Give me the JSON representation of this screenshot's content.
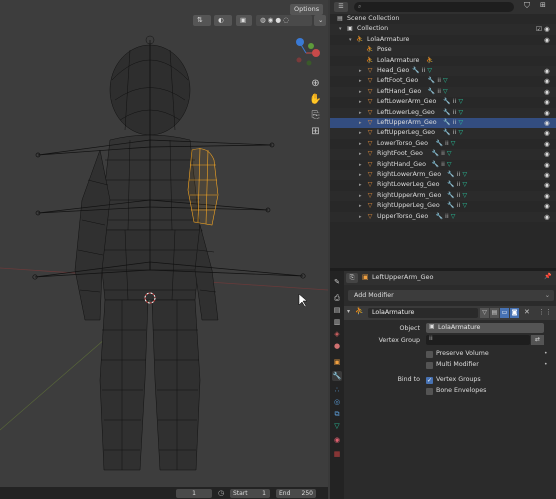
{
  "viewport": {
    "options_label": "Options"
  },
  "timeline": {
    "frame": "1",
    "start_label": "Start",
    "start": "1",
    "end_label": "End",
    "end": "250"
  },
  "outliner": {
    "rows": [
      {
        "label": "Scene Collection",
        "icon": "scene-collection-icon",
        "depth": 0
      },
      {
        "label": "Collection",
        "icon": "collection-icon",
        "depth": 1,
        "check": true
      },
      {
        "label": "LolaArmature",
        "icon": "armature-object-icon",
        "depth": 2,
        "expanded": true
      },
      {
        "label": "Pose",
        "icon": "pose-icon",
        "depth": 3
      },
      {
        "label": "LolaArmature",
        "icon": "armature-data-icon",
        "depth": 3
      },
      {
        "label": "Head_Geo",
        "icon": "mesh-object-icon",
        "depth": 3,
        "mods": "wrench,group,mesh"
      },
      {
        "label": "LeftFoot_Geo",
        "icon": "mesh-object-icon",
        "depth": 3,
        "mods": "wrench,group,mesh"
      },
      {
        "label": "LeftHand_Geo",
        "icon": "mesh-object-icon",
        "depth": 3,
        "mods": "wrench,group,mesh"
      },
      {
        "label": "LeftLowerArm_Geo",
        "icon": "mesh-object-icon",
        "depth": 3,
        "mods": "wrench,group,mesh"
      },
      {
        "label": "LeftLowerLeg_Geo",
        "icon": "mesh-object-icon",
        "depth": 3,
        "mods": "wrench,group,mesh"
      },
      {
        "label": "LeftUpperArm_Geo",
        "icon": "mesh-object-icon",
        "depth": 3,
        "mods": "wrench,group,mesh",
        "selected": true
      },
      {
        "label": "LeftUpperLeg_Geo",
        "icon": "mesh-object-icon",
        "depth": 3,
        "mods": "wrench,group,mesh"
      },
      {
        "label": "LowerTorso_Geo",
        "icon": "mesh-object-icon",
        "depth": 3,
        "mods": "wrench,group,mesh"
      },
      {
        "label": "RightFoot_Geo",
        "icon": "mesh-object-icon",
        "depth": 3,
        "mods": "wrench,group,mesh"
      },
      {
        "label": "RightHand_Geo",
        "icon": "mesh-object-icon",
        "depth": 3,
        "mods": "wrench,group,mesh"
      },
      {
        "label": "RightLowerArm_Geo",
        "icon": "mesh-object-icon",
        "depth": 3,
        "mods": "wrench,group,mesh"
      },
      {
        "label": "RightLowerLeg_Geo",
        "icon": "mesh-object-icon",
        "depth": 3,
        "mods": "wrench,group,mesh"
      },
      {
        "label": "RightUpperArm_Geo",
        "icon": "mesh-object-icon",
        "depth": 3,
        "mods": "wrench,group,mesh"
      },
      {
        "label": "RightUpperLeg_Geo",
        "icon": "mesh-object-icon",
        "depth": 3,
        "mods": "wrench,group,mesh"
      },
      {
        "label": "UpperTorso_Geo",
        "icon": "mesh-object-icon",
        "depth": 3,
        "mods": "wrench,group,mesh"
      }
    ]
  },
  "properties": {
    "object_name": "LeftUpperArm_Geo",
    "add_modifier": "Add Modifier",
    "modifier_name": "LolaArmature",
    "object_label": "Object",
    "object_value": "LolaArmature",
    "vertex_group_label": "Vertex Group",
    "preserve_volume": "Preserve Volume",
    "multi_modifier": "Multi Modifier",
    "bind_to_label": "Bind to",
    "vertex_groups": "Vertex Groups",
    "bone_envelopes": "Bone Envelopes"
  },
  "colors": {
    "selection": "#334d80",
    "accent": "#4772b3",
    "mesh_icon": "#e8903c",
    "mesh_data": "#27c9a0",
    "bone_select": "#f5a623"
  }
}
